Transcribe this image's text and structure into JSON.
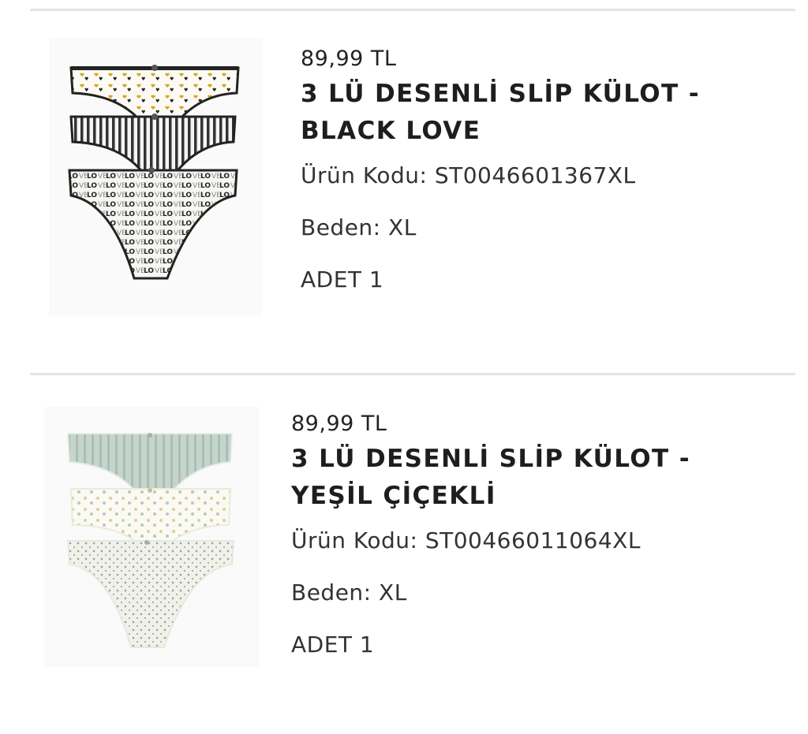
{
  "cart": {
    "items": [
      {
        "price": "89,99 TL",
        "title_line1": "3 LÜ DESENLİ SLİP KÜLOT -",
        "title_line2": "BLACK LOVE",
        "code": "Ürün Kodu: ST0046601367XL",
        "size": "Beden: XL",
        "qty": "ADET 1",
        "image_icon": "black-love-briefs-image",
        "colors": {
          "band": "#e8d9a8",
          "accent": "#d6a820",
          "dark": "#1a1a1a"
        }
      },
      {
        "price": "89,99 TL",
        "title_line1": "3 LÜ DESENLİ SLİP KÜLOT -",
        "title_line2": "YEŞİL ÇİÇEKLİ",
        "code": "Ürün Kodu: ST00466011064XL",
        "size": "Beden: XL",
        "qty": "ADET 1",
        "image_icon": "green-floral-briefs-image",
        "colors": {
          "band": "#b9cbc2",
          "accent": "#d9cfa0",
          "dark": "#8fa59a"
        }
      }
    ]
  }
}
